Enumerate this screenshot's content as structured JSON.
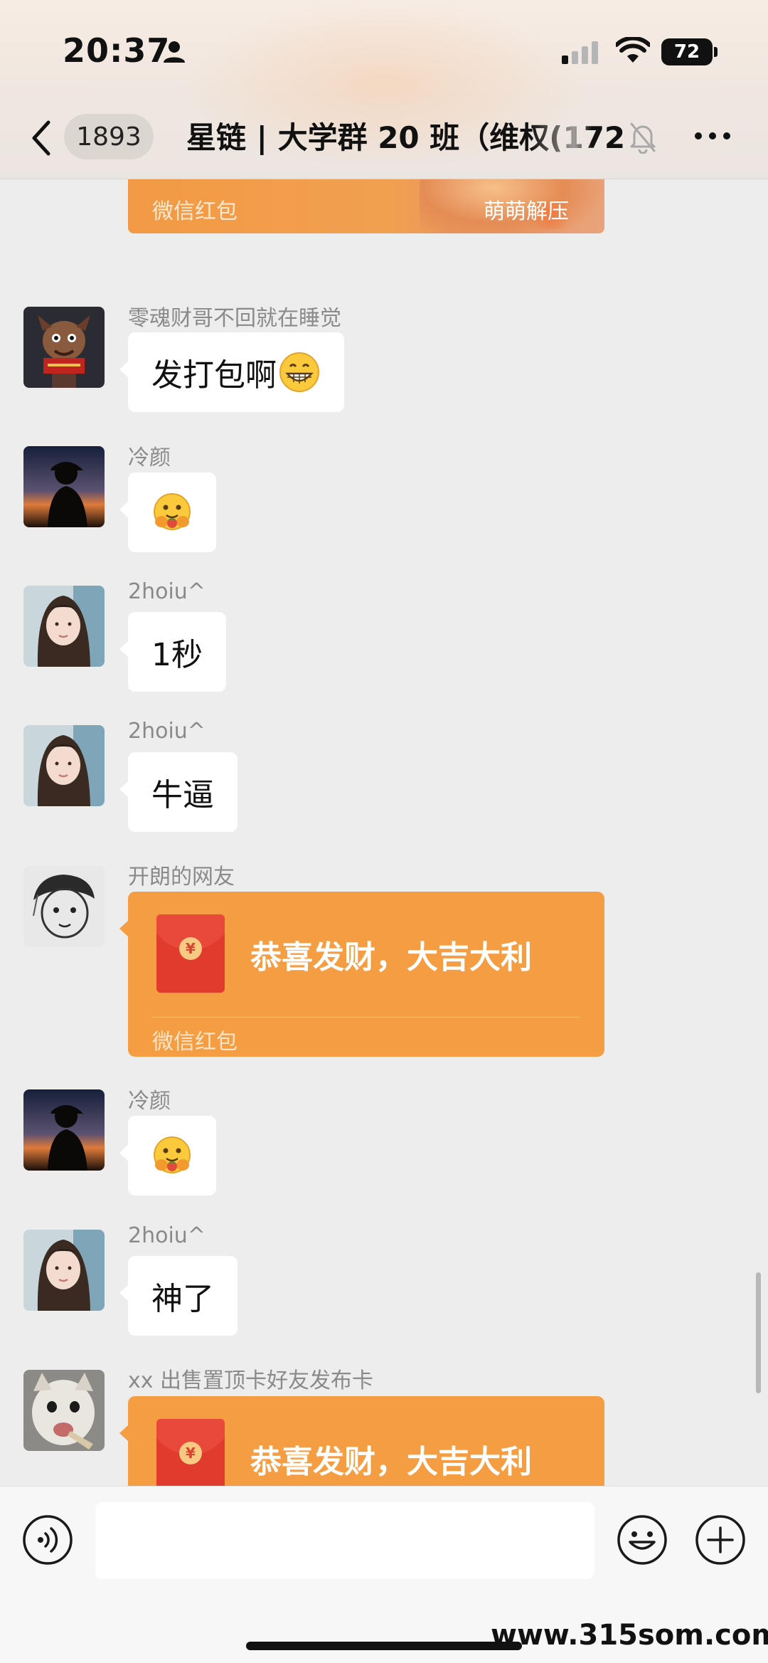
{
  "status_bar": {
    "time": "20:37",
    "battery": "72"
  },
  "nav": {
    "unread_count": "1893",
    "title": "星链 | 大学群 20 班（维权(172)"
  },
  "partial_redpacket": {
    "label": "微信红包",
    "right_text": "萌萌解压"
  },
  "messages": [
    {
      "sender": "零魂财哥不回就在睡觉",
      "text": "发打包啊",
      "emoji": "grinning-face"
    },
    {
      "sender": "冷颜",
      "emoji": "hugging-face"
    },
    {
      "sender": "2hoiu^",
      "text": "1秒"
    },
    {
      "sender": "2hoiu^",
      "text": "牛逼"
    },
    {
      "sender": "开朗的网友",
      "redpacket_text": "恭喜发财，大吉大利",
      "redpacket_label": "微信红包"
    },
    {
      "sender": "冷颜",
      "emoji": "hugging-face"
    },
    {
      "sender": "2hoiu^",
      "text": "神了"
    },
    {
      "sender": "xx 出售置顶卡好友发布卡",
      "redpacket_text": "恭喜发财，大吉大利"
    }
  ],
  "redpacket_coin": "¥",
  "watermark": "www.315som.com",
  "colors": {
    "redpacket": "#f59d42",
    "background": "#ededed",
    "bubble": "#ffffff"
  }
}
